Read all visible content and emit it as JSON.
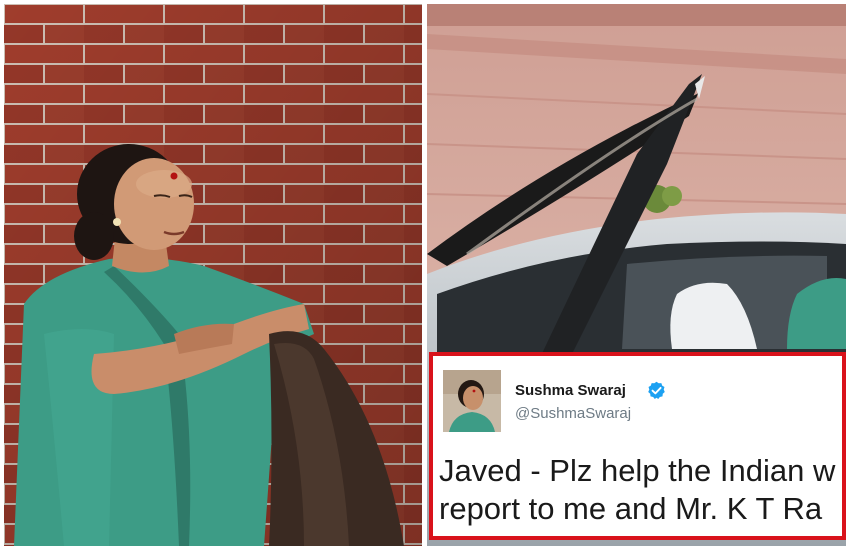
{
  "tweet": {
    "name": "Sushma Swaraj",
    "handle": "@SushmaSwaraj",
    "text_line1": "Javed - Plz help the Indian w",
    "text_line2": "report to me and Mr. K T Ra"
  },
  "icons": {
    "verified": "verified-badge-icon"
  },
  "colors": {
    "brick": "#a8402f",
    "mortar": "#d8c9bd",
    "saree_green": "#3d9c86",
    "card_border": "#d9121b",
    "verified_blue": "#1da1f2",
    "handle_gray": "#6e7b85"
  }
}
